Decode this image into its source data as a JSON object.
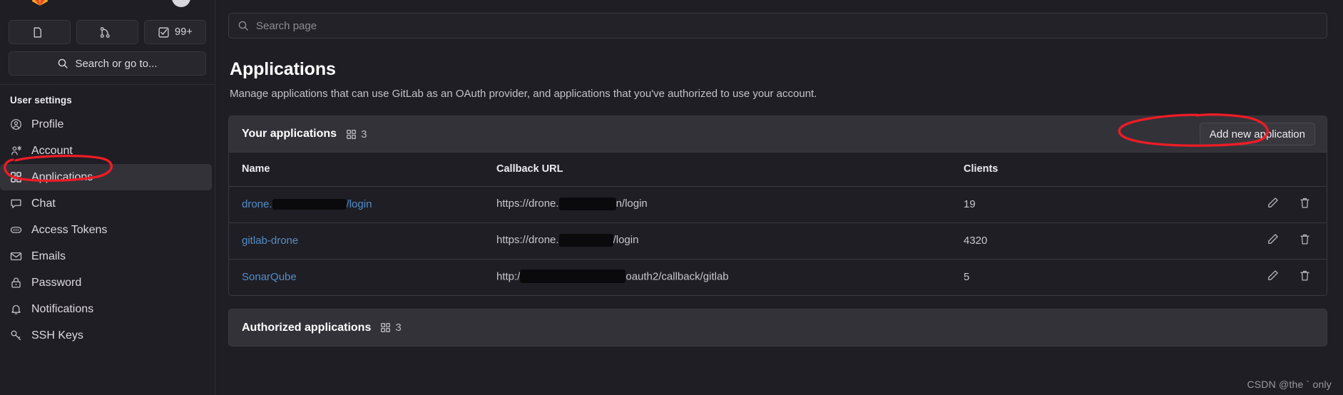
{
  "sidebar": {
    "icon_buttons": [
      {
        "name": "issues-icon",
        "glyph": "issue",
        "count": ""
      },
      {
        "name": "merge-requests-icon",
        "glyph": "merge",
        "count": ""
      },
      {
        "name": "todos-icon",
        "glyph": "todo",
        "count": "99+"
      }
    ],
    "search": {
      "label": "Search or go to...",
      "icon": "search-icon"
    },
    "section_title": "User settings",
    "items": [
      {
        "label": "Profile",
        "icon": "user-circle-icon",
        "active": false
      },
      {
        "label": "Account",
        "icon": "user-gear-icon",
        "active": false
      },
      {
        "label": "Applications",
        "icon": "apps-grid-icon",
        "active": true
      },
      {
        "label": "Chat",
        "icon": "comment-icon",
        "active": false
      },
      {
        "label": "Access Tokens",
        "icon": "token-icon",
        "active": false
      },
      {
        "label": "Emails",
        "icon": "envelope-icon",
        "active": false
      },
      {
        "label": "Password",
        "icon": "lock-icon",
        "active": false
      },
      {
        "label": "Notifications",
        "icon": "bell-icon",
        "active": false
      },
      {
        "label": "SSH Keys",
        "icon": "key-icon",
        "active": false
      }
    ]
  },
  "main": {
    "search_placeholder": "Search page",
    "title": "Applications",
    "description": "Manage applications that can use GitLab as an OAuth provider, and applications that you've authorized to use your account.",
    "your_applications": {
      "heading": "Your applications",
      "count": "3",
      "add_button": "Add new application",
      "columns": [
        "Name",
        "Callback URL",
        "Clients"
      ],
      "rows": [
        {
          "name_prefix": "drone.",
          "name_redacted": true,
          "name_suffix": "/login",
          "callback_prefix": "https://drone.",
          "callback_redacted": true,
          "callback_suffix": "n/login",
          "clients": "19",
          "edit": "edit-icon",
          "delete": "delete-icon"
        },
        {
          "name_prefix": "gitlab-drone",
          "name_redacted": false,
          "name_suffix": "",
          "callback_prefix": "https://drone.",
          "callback_redacted": true,
          "callback_suffix": "/login",
          "clients": "4320",
          "edit": "edit-icon",
          "delete": "delete-icon"
        },
        {
          "name_prefix": "SonarQube",
          "name_redacted": false,
          "name_suffix": "",
          "callback_prefix": "http:/",
          "callback_redacted": true,
          "callback_suffix": "oauth2/callback/gitlab",
          "clients": "5",
          "edit": "edit-icon",
          "delete": "delete-icon"
        }
      ]
    },
    "authorized_applications": {
      "heading": "Authorized applications",
      "count": "3"
    }
  },
  "watermark": "CSDN @the ` only",
  "colors": {
    "background": "#1f1e24",
    "panel_header": "#343239",
    "border": "#3a393f",
    "link": "#528ec9",
    "accent_active": "#428fdc",
    "annotation_red": "#ee1c25",
    "logo_orange": "#fc6d26"
  }
}
